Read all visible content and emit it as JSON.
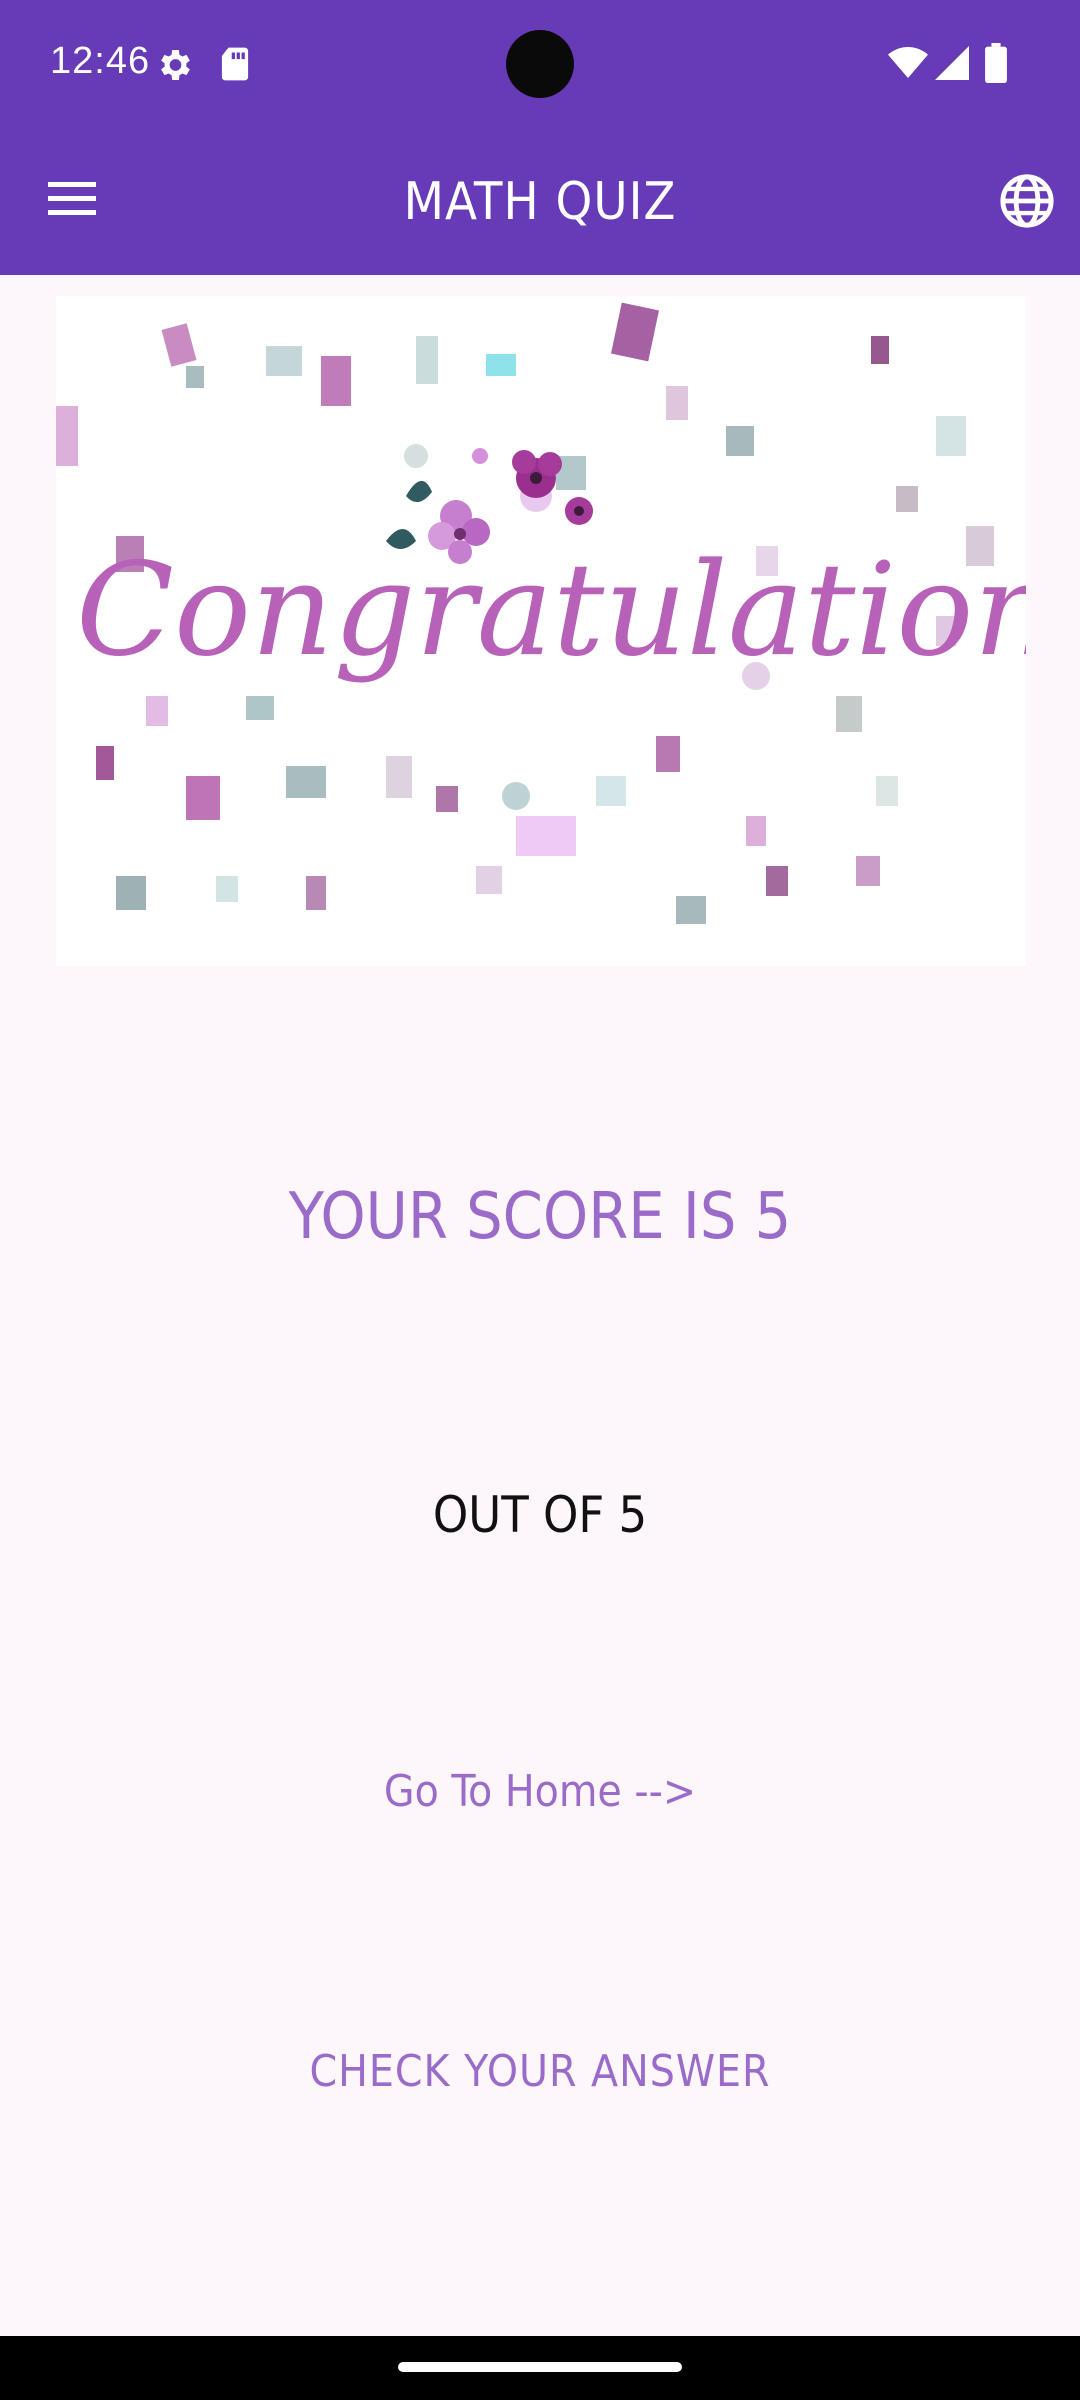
{
  "status_bar": {
    "time": "12:46",
    "icons": [
      "settings-icon",
      "sd-card-icon",
      "wifi-icon",
      "cellular-signal-icon",
      "battery-icon"
    ]
  },
  "app_bar": {
    "title": "MATH QUIZ",
    "menu_icon": "hamburger-menu-icon",
    "language_icon": "globe-icon",
    "color": "#673ab7"
  },
  "banner": {
    "text": "Congratulations!"
  },
  "result": {
    "score_text": "YOUR SCORE IS 5",
    "out_of_text": "OUT OF 5",
    "accent_color": "#9a6bc9"
  },
  "actions": {
    "home_link": "Go To Home -->",
    "check_answer": "CHECK YOUR ANSWER"
  }
}
